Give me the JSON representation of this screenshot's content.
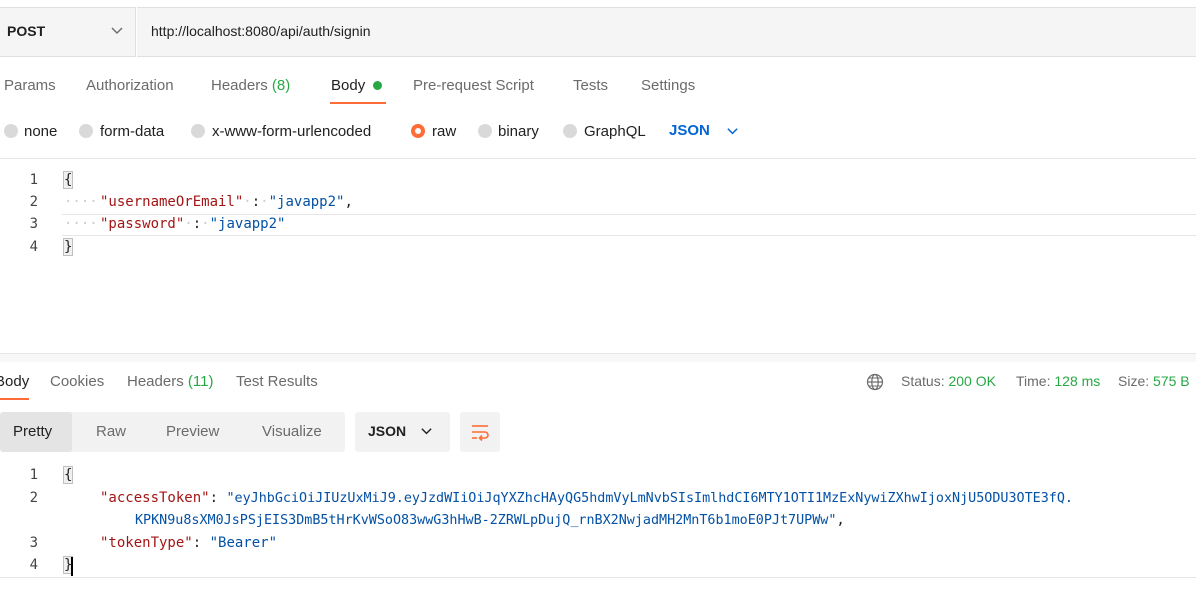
{
  "request": {
    "method": "POST",
    "url": "http://localhost:8080/api/auth/signin"
  },
  "request_tabs": [
    {
      "label": "Params"
    },
    {
      "label": "Authorization"
    },
    {
      "label": "Headers",
      "count": "(8)"
    },
    {
      "label": "Body",
      "active": true
    },
    {
      "label": "Pre-request Script"
    },
    {
      "label": "Tests"
    },
    {
      "label": "Settings"
    }
  ],
  "body_types": [
    {
      "label": "none"
    },
    {
      "label": "form-data"
    },
    {
      "label": "x-www-form-urlencoded"
    },
    {
      "label": "raw",
      "selected": true
    },
    {
      "label": "binary"
    },
    {
      "label": "GraphQL"
    }
  ],
  "raw_format": "JSON",
  "request_body": {
    "line_numbers": [
      "1",
      "2",
      "3",
      "4"
    ],
    "open_brace": "{",
    "close_brace": "}",
    "key1": "\"usernameOrEmail\"",
    "val1": "\"javapp2\"",
    "key2": "\"password\"",
    "val2": "\"javapp2\"",
    "colon": ":",
    "comma": ","
  },
  "response_tabs": [
    {
      "label": "Body",
      "active": true
    },
    {
      "label": "Cookies"
    },
    {
      "label": "Headers",
      "count": "(11)"
    },
    {
      "label": "Test Results"
    }
  ],
  "response_meta": {
    "status_label": "Status:",
    "status_value": "200 OK",
    "time_label": "Time:",
    "time_value": "128 ms",
    "size_label": "Size:",
    "size_value": "575 B"
  },
  "view_modes": [
    {
      "label": "Pretty",
      "active": true
    },
    {
      "label": "Raw"
    },
    {
      "label": "Preview"
    },
    {
      "label": "Visualize"
    }
  ],
  "response_format": "JSON",
  "response_body": {
    "line_numbers": [
      "1",
      "2",
      "3",
      "4"
    ],
    "open_brace": "{",
    "close_brace": "}",
    "key1": "\"accessToken\"",
    "val1_line1": "\"eyJhbGciOiJIUzUxMiJ9.eyJzdWIiOiJqYXZhcHAyQG5hdmVyLmNvbSIsImlhdCI6MTY1OTI1MzExNywiZXhwIjoxNjU5ODU3OTE3fQ.",
    "val1_line2": "KPKN9u8sXM0JsPSjEIS3DmB5tHrKvWSoO83wwG3hHwB-2ZRWLpDujQ_rnBX2NwjadMH2MnT6b1moE0PJt7UPWw\"",
    "key2": "\"tokenType\"",
    "val2": "\"Bearer\"",
    "colon": ":",
    "comma": ","
  },
  "colors": {
    "accent": "#ff6c37",
    "success": "#28a745",
    "link": "#0265d2"
  },
  "icons": [
    "chevron-down-icon",
    "globe-icon",
    "wrap-lines-icon"
  ]
}
